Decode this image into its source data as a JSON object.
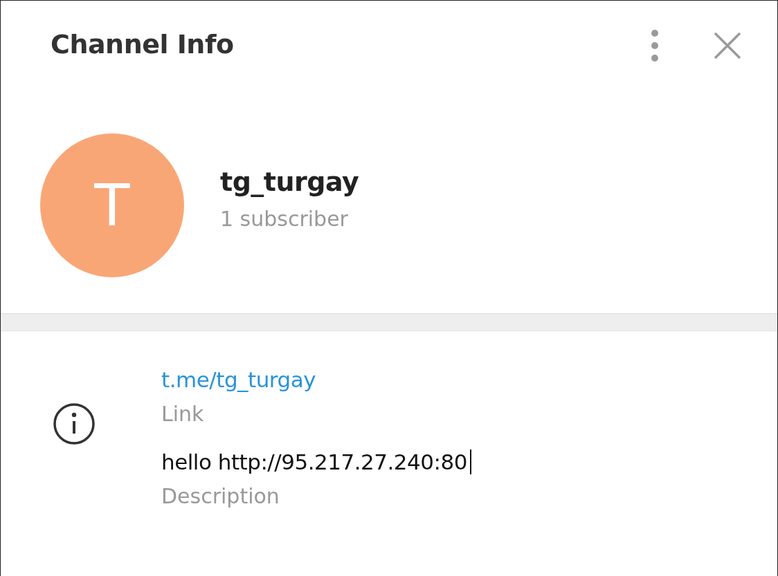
{
  "header": {
    "title": "Channel Info"
  },
  "profile": {
    "initial": "T",
    "name": "tg_turgay",
    "subscribers": "1 subscriber"
  },
  "info": [
    {
      "kind": "link",
      "value": "t.me/tg_turgay",
      "label": "Link",
      "caret": false
    },
    {
      "kind": "text",
      "value": "hello http://95.217.27.240:80",
      "label": "Description",
      "caret": true
    }
  ]
}
